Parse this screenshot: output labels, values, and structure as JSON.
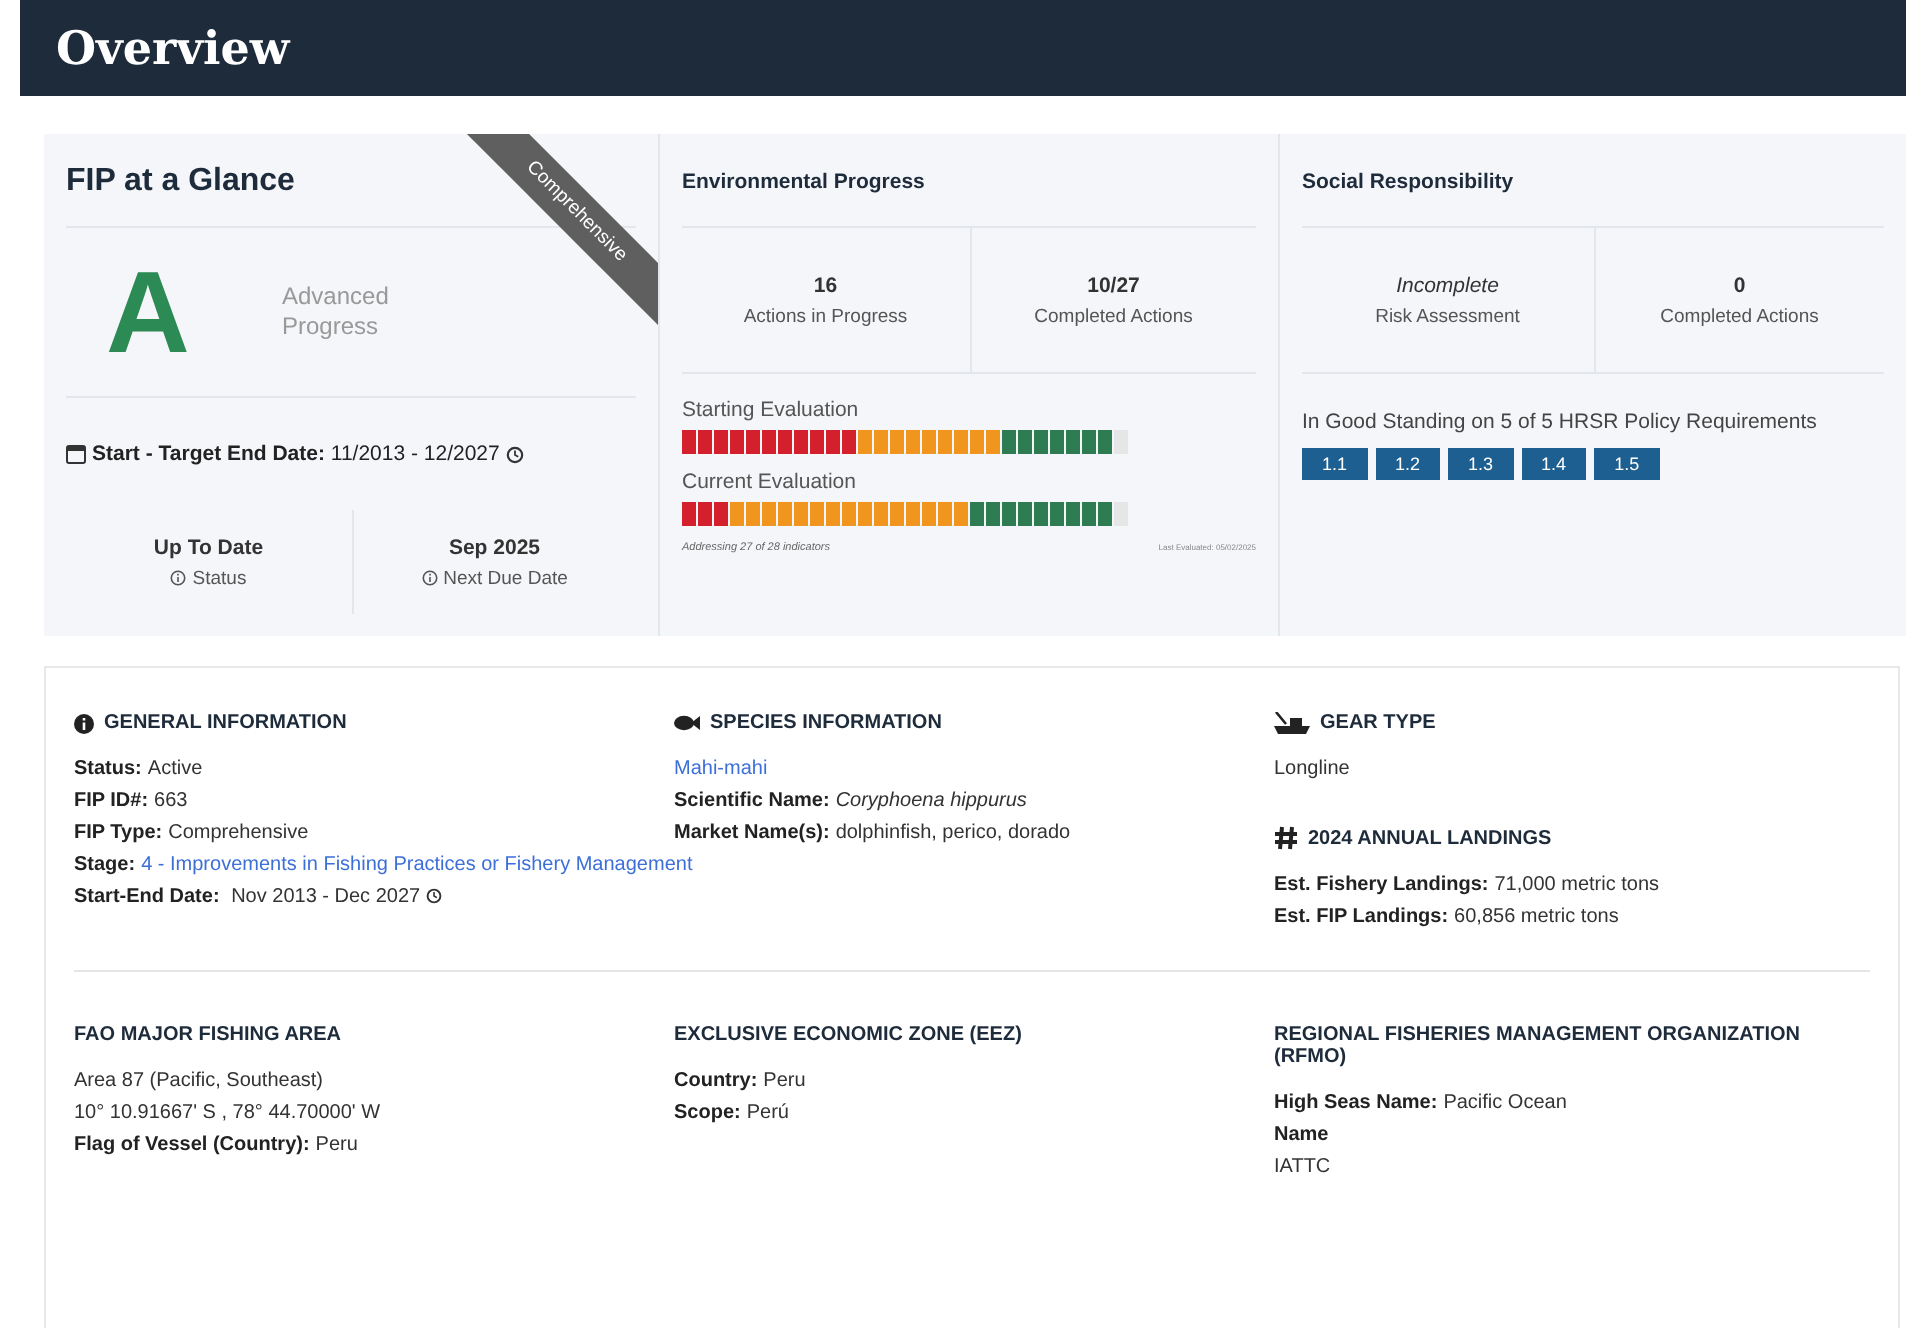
{
  "header": {
    "title": "Overview"
  },
  "glance": {
    "title": "FIP at a Glance",
    "ribbon": "Comprehensive",
    "grade": "A",
    "grade_label": "Advanced Progress",
    "dates_label": "Start - Target End Date:",
    "dates_value": "11/2013 - 12/2027",
    "stats": [
      {
        "value": "Up To Date",
        "label": "Status"
      },
      {
        "value": "Sep 2025",
        "label": "Next Due Date"
      }
    ]
  },
  "environmental": {
    "title": "Environmental Progress",
    "stats": [
      {
        "value": "16",
        "label": "Actions in Progress"
      },
      {
        "value": "10/27",
        "label": "Completed Actions"
      }
    ],
    "evaluations": [
      {
        "label": "Starting Evaluation",
        "segments": [
          {
            "color": "#d3202c"
          },
          {
            "color": "#d3202c"
          },
          {
            "color": "#d3202c"
          },
          {
            "color": "#d3202c"
          },
          {
            "color": "#d3202c"
          },
          {
            "color": "#d3202c"
          },
          {
            "color": "#d3202c"
          },
          {
            "color": "#d3202c"
          },
          {
            "color": "#d3202c"
          },
          {
            "color": "#d3202c"
          },
          {
            "color": "#d3202c"
          },
          {
            "color": "#f0951e"
          },
          {
            "color": "#f0951e"
          },
          {
            "color": "#f0951e"
          },
          {
            "color": "#f0951e"
          },
          {
            "color": "#f0951e"
          },
          {
            "color": "#f0951e"
          },
          {
            "color": "#f0951e"
          },
          {
            "color": "#f0951e"
          },
          {
            "color": "#f0951e"
          },
          {
            "color": "#2e7d52"
          },
          {
            "color": "#2e7d52"
          },
          {
            "color": "#2e7d52"
          },
          {
            "color": "#2e7d52"
          },
          {
            "color": "#2e7d52"
          },
          {
            "color": "#2e7d52"
          },
          {
            "color": "#2e7d52"
          },
          {
            "color": "#e6e6e6"
          }
        ]
      },
      {
        "label": "Current Evaluation",
        "segments": [
          {
            "color": "#d3202c"
          },
          {
            "color": "#d3202c"
          },
          {
            "color": "#d3202c"
          },
          {
            "color": "#f0951e"
          },
          {
            "color": "#f0951e"
          },
          {
            "color": "#f0951e"
          },
          {
            "color": "#f0951e"
          },
          {
            "color": "#f0951e"
          },
          {
            "color": "#f0951e"
          },
          {
            "color": "#f0951e"
          },
          {
            "color": "#f0951e"
          },
          {
            "color": "#f0951e"
          },
          {
            "color": "#f0951e"
          },
          {
            "color": "#f0951e"
          },
          {
            "color": "#f0951e"
          },
          {
            "color": "#f0951e"
          },
          {
            "color": "#f0951e"
          },
          {
            "color": "#f0951e"
          },
          {
            "color": "#2e7d52"
          },
          {
            "color": "#2e7d52"
          },
          {
            "color": "#2e7d52"
          },
          {
            "color": "#2e7d52"
          },
          {
            "color": "#2e7d52"
          },
          {
            "color": "#2e7d52"
          },
          {
            "color": "#2e7d52"
          },
          {
            "color": "#2e7d52"
          },
          {
            "color": "#2e7d52"
          },
          {
            "color": "#e6e6e6"
          }
        ]
      }
    ],
    "footnote": "Addressing 27 of 28 indicators",
    "last_evaluated": "Last Evaluated: 05/02/2025"
  },
  "social": {
    "title": "Social Responsibility",
    "stats": [
      {
        "value": "Incomplete",
        "label": "Risk Assessment",
        "italic": true
      },
      {
        "value": "0",
        "label": "Completed Actions",
        "italic": false
      }
    ],
    "standing": "In Good Standing on 5 of 5 HRSR Policy Requirements",
    "policies": [
      "1.1",
      "1.2",
      "1.3",
      "1.4",
      "1.5"
    ]
  },
  "rows": [
    {
      "columns": [
        {
          "blocks": [
            {
              "title": "GENERAL INFORMATION",
              "kind": "info",
              "lines": [
                {
                  "label": "Status:",
                  "value": "Active"
                },
                {
                  "label": "FIP ID#:",
                  "value": "663"
                },
                {
                  "label": "FIP Type:",
                  "value": "Comprehensive"
                },
                {
                  "label": "Stage:",
                  "link": "4 - Improvements in Fishing Practices or Fishery Management"
                },
                {
                  "label": "Start-End Date:",
                  "value": "Nov 2013 - Dec 2027",
                  "history": true
                }
              ]
            }
          ]
        },
        {
          "blocks": [
            {
              "title": "SPECIES INFORMATION",
              "kind": "fish",
              "lines": [
                {
                  "link": "Mahi-mahi"
                },
                {
                  "label": "Scientific Name:",
                  "value": "*Coryphoena hippurus*"
                },
                {
                  "label": "Market Name(s):",
                  "value": "dolphinfish, perico, dorado"
                }
              ]
            }
          ]
        },
        {
          "blocks": [
            {
              "title": "GEAR TYPE",
              "kind": "ship",
              "lines": [
                {
                  "value": "Longline"
                }
              ]
            },
            {
              "title": "2024 ANNUAL LANDINGS",
              "kind": "hash",
              "lines": [
                {
                  "label": "Est. Fishery Landings:",
                  "value": "71,000 metric tons"
                },
                {
                  "label": "Est. FIP Landings:",
                  "value": "60,856 metric tons"
                }
              ]
            }
          ]
        }
      ]
    },
    {
      "columns": [
        {
          "blocks": [
            {
              "title": "FAO MAJOR FISHING AREA",
              "lines": [
                {
                  "value": "Area 87 (Pacific, Southeast)"
                },
                {
                  "value": "10° 10.91667' S , 78° 44.70000' W"
                },
                {
                  "label": "Flag of Vessel (Country):",
                  "value": "Peru"
                }
              ]
            }
          ]
        },
        {
          "blocks": [
            {
              "title": "EXCLUSIVE ECONOMIC ZONE (EEZ)",
              "lines": [
                {
                  "label": "Country:",
                  "value": "Peru"
                },
                {
                  "label": "Scope:",
                  "value": "Perú"
                }
              ]
            }
          ]
        },
        {
          "blocks": [
            {
              "title": "REGIONAL FISHERIES MANAGEMENT ORGANIZATION (RFMO)",
              "lines": [
                {
                  "label": "High Seas Name:",
                  "value": "Pacific Ocean"
                },
                {
                  "label": "Name"
                },
                {
                  "value": "IATTC"
                }
              ]
            }
          ]
        }
      ]
    }
  ]
}
